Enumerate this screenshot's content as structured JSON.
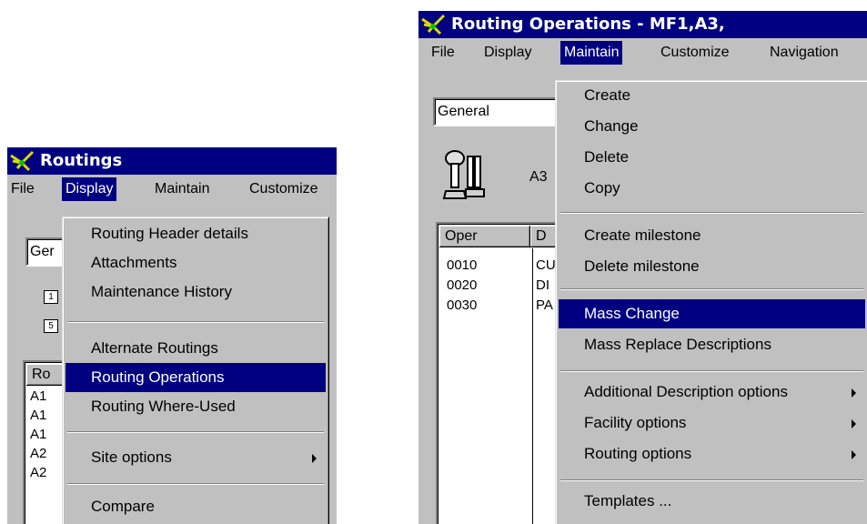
{
  "left_window": {
    "title": "Routings",
    "menu": [
      "File",
      "Display",
      "Maintain",
      "Customize"
    ],
    "combo_value": "Ger",
    "status_rows": [
      "1",
      "5"
    ],
    "list": {
      "header": "Ro",
      "rows": [
        "A1",
        "A1",
        "A1",
        "A2",
        "A2"
      ]
    },
    "display_menu": {
      "groups": [
        [
          "Routing Header details",
          "Attachments",
          "Maintenance History"
        ],
        [
          "Alternate Routings",
          "Routing Operations",
          "Routing Where-Used"
        ],
        [
          "Site options"
        ],
        [
          "Compare"
        ]
      ],
      "highlighted": "Routing Operations",
      "submenu_items": [
        "Site options"
      ]
    }
  },
  "right_window": {
    "title": "Routing Operations - MF1,A3,",
    "menu": [
      "File",
      "Display",
      "Maintain",
      "Customize",
      "Navigation"
    ],
    "combo_value": "General",
    "icon_label": "A3",
    "list": {
      "headers": [
        "Oper",
        "D"
      ],
      "rows": [
        {
          "oper": "0010",
          "desc": "CU"
        },
        {
          "oper": "0020",
          "desc": "DI"
        },
        {
          "oper": "0030",
          "desc": "PA"
        }
      ]
    },
    "maintain_menu": {
      "groups": [
        [
          "Create",
          "Change",
          "Delete",
          "Copy"
        ],
        [
          "Create milestone",
          "Delete milestone"
        ],
        [
          "Mass Change",
          "Mass Replace Descriptions"
        ],
        [
          "Additional Description options",
          "Facility options",
          "Routing options"
        ],
        [
          "Templates ..."
        ]
      ],
      "highlighted": "Mass Change",
      "submenu_items": [
        "Additional Description options",
        "Facility options",
        "Routing options"
      ]
    }
  },
  "colors": {
    "titlebar": "#000080",
    "highlight": "#000080",
    "face": "#c0c0c0"
  }
}
